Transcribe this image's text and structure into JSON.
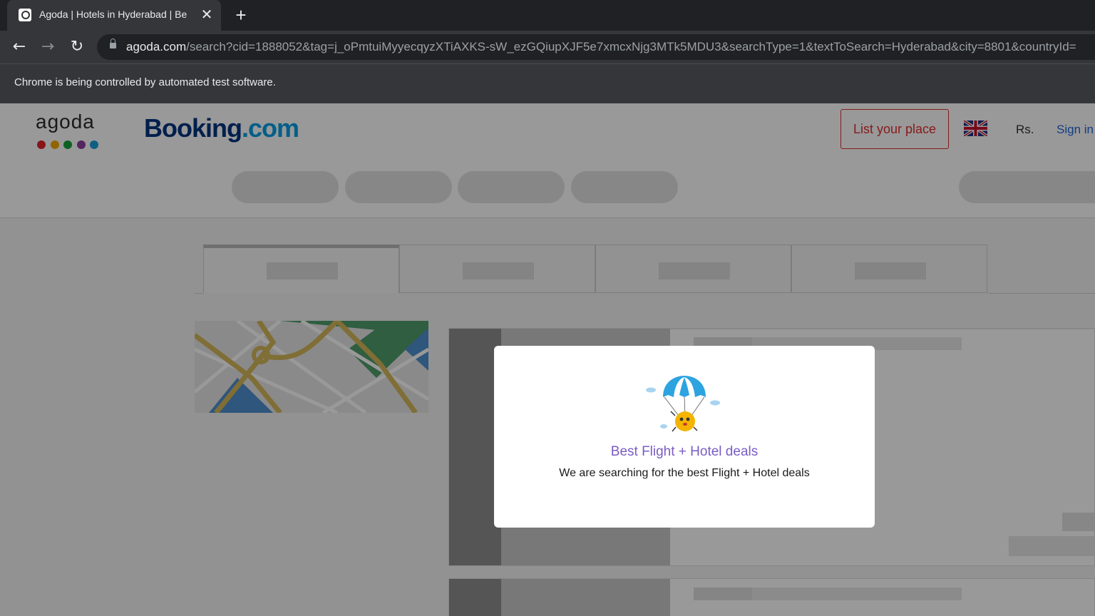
{
  "browser": {
    "tab_title": "Agoda | Hotels in Hyderabad | Be",
    "close_glyph": "✕",
    "new_tab_glyph": "+",
    "back_glyph": "←",
    "forward_glyph": "→",
    "reload_glyph": "↻",
    "url_domain": "agoda.com",
    "url_path": "/search?cid=1888052&tag=j_oPmtuiMyyecqyzXTiAXKS-sW_ezGQiupXJF5e7xmcxNjg3MTk5MDU3&searchType=1&textToSearch=Hyderabad&city=8801&countryId=",
    "infobar_text": "Chrome is being controlled by automated test software."
  },
  "header": {
    "agoda_logo_text": "agoda",
    "agoda_dot_colors": [
      "#e0252c",
      "#f0a800",
      "#14a03c",
      "#8c3f9e",
      "#1a9ed9"
    ],
    "booking_main": "Booking",
    "booking_suffix": ".com",
    "list_place_label": "List your place",
    "currency": "Rs.",
    "signin_label": "Sign in",
    "flag_icon": "uk-flag-icon"
  },
  "modal": {
    "title": "Best Flight + Hotel deals",
    "subtitle": "We are searching for the best Flight + Hotel deals",
    "title_color": "#7a5cc4",
    "mascot_icon": "parachute-mascot-icon"
  },
  "colors": {
    "brand_red": "#e12d2d",
    "link_blue": "#2067da",
    "booking_navy": "#003580",
    "booking_cyan": "#009fe3"
  }
}
